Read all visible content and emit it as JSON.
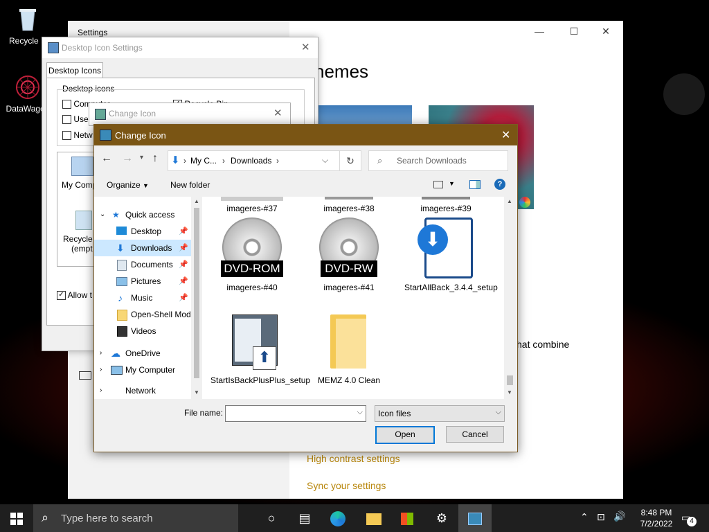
{
  "desktop": {
    "icons": [
      {
        "label": "Recycle B"
      },
      {
        "label": "DataWagon"
      }
    ]
  },
  "settings": {
    "title": "Settings",
    "heading": "hemes",
    "partial_text": "hat combine",
    "links": [
      "High contrast settings",
      "Sync your settings"
    ]
  },
  "desktop_icon_settings": {
    "title": "Desktop Icon Settings",
    "tab": "Desktop Icons",
    "group": "Desktop icons",
    "checkboxes": [
      {
        "label": "Computer",
        "checked": false
      },
      {
        "label": "User",
        "checked": false
      },
      {
        "label": "Netw",
        "checked": false
      },
      {
        "label": "Recycle Bin",
        "checked": true
      }
    ],
    "preview": [
      {
        "label": "My Comp"
      },
      {
        "label": "Recycle"
      },
      {
        "label": "(empt"
      }
    ],
    "allow": "Allow t"
  },
  "change_icon_back": {
    "title": "Change Icon"
  },
  "dialog": {
    "title": "Change Icon",
    "breadcrumb": [
      "My C...",
      "Downloads"
    ],
    "search_placeholder": "Search Downloads",
    "toolbar": {
      "organize": "Organize",
      "new_folder": "New folder"
    },
    "nav": [
      {
        "label": "Quick access",
        "level": 0,
        "pinned": false,
        "selected": false
      },
      {
        "label": "Desktop",
        "level": 1,
        "pinned": true,
        "selected": false
      },
      {
        "label": "Downloads",
        "level": 1,
        "pinned": true,
        "selected": true
      },
      {
        "label": "Documents",
        "level": 1,
        "pinned": true,
        "selected": false
      },
      {
        "label": "Pictures",
        "level": 1,
        "pinned": true,
        "selected": false
      },
      {
        "label": "Music",
        "level": 1,
        "pinned": true,
        "selected": false
      },
      {
        "label": "Open-Shell Mod",
        "level": 1,
        "pinned": false,
        "selected": false
      },
      {
        "label": "Videos",
        "level": 1,
        "pinned": false,
        "selected": false
      },
      {
        "label": "OneDrive",
        "level": 0,
        "pinned": false,
        "selected": false
      },
      {
        "label": "My Computer",
        "level": 0,
        "pinned": false,
        "selected": false
      },
      {
        "label": "Network",
        "level": 0,
        "pinned": false,
        "selected": false
      }
    ],
    "files": [
      {
        "label": "imageres-#37"
      },
      {
        "label": "imageres-#38"
      },
      {
        "label": "imageres-#39"
      },
      {
        "label": "imageres-#40",
        "disc": "DVD-ROM"
      },
      {
        "label": "imageres-#41",
        "disc": "DVD-RW"
      },
      {
        "label": "StartAllBack_3.4.4_setup"
      },
      {
        "label": "StartIsBackPlusPlus_setup"
      },
      {
        "label": "MEMZ 4.0 Clean"
      }
    ],
    "file_name_label": "File name:",
    "file_name_value": "",
    "filter": "Icon files",
    "open": "Open",
    "cancel": "Cancel"
  },
  "taskbar": {
    "search_placeholder": "Type here to search",
    "time": "8:48 PM",
    "date": "7/2/2022",
    "notifications": "4"
  }
}
